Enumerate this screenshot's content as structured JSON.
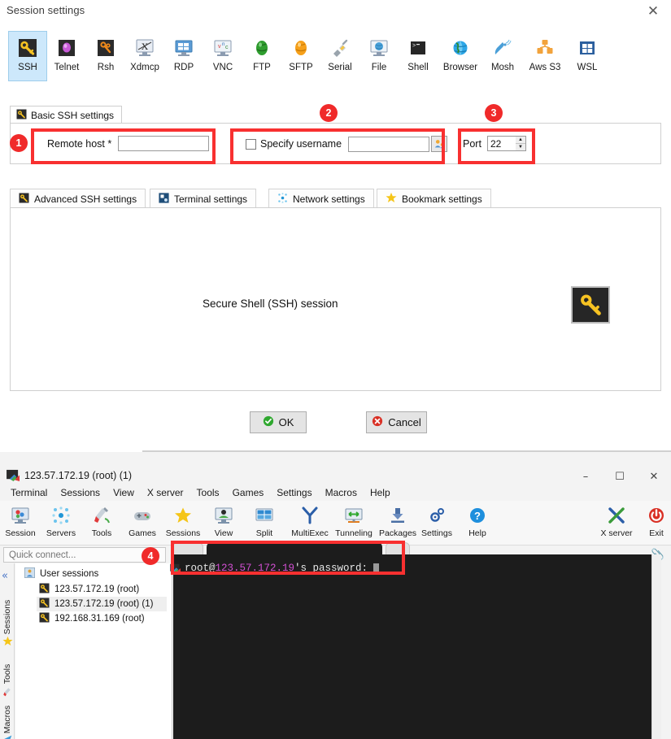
{
  "dialog": {
    "title": "Session settings",
    "close_label": "✕",
    "protocols": [
      {
        "label": "SSH",
        "icon": "ssh-key-icon",
        "selected": true
      },
      {
        "label": "Telnet",
        "icon": "telnet-icon",
        "selected": false
      },
      {
        "label": "Rsh",
        "icon": "rsh-icon",
        "selected": false
      },
      {
        "label": "Xdmcp",
        "icon": "xdmcp-icon",
        "selected": false
      },
      {
        "label": "RDP",
        "icon": "rdp-icon",
        "selected": false
      },
      {
        "label": "VNC",
        "icon": "vnc-icon",
        "selected": false
      },
      {
        "label": "FTP",
        "icon": "ftp-globe-icon",
        "selected": false
      },
      {
        "label": "SFTP",
        "icon": "sftp-globe-icon",
        "selected": false
      },
      {
        "label": "Serial",
        "icon": "serial-plug-icon",
        "selected": false
      },
      {
        "label": "File",
        "icon": "file-monitor-icon",
        "selected": false
      },
      {
        "label": "Shell",
        "icon": "shell-console-icon",
        "selected": false
      },
      {
        "label": "Browser",
        "icon": "browser-globe-icon",
        "selected": false
      },
      {
        "label": "Mosh",
        "icon": "mosh-satellite-icon",
        "selected": false
      },
      {
        "label": "Aws S3",
        "icon": "aws-s3-icon",
        "selected": false
      },
      {
        "label": "WSL",
        "icon": "wsl-windows-icon",
        "selected": false
      }
    ],
    "basic_tab": {
      "label": "Basic SSH settings",
      "icon": "ssh-key-icon"
    },
    "basic_fields": {
      "remote_host_label": "Remote host *",
      "remote_host_value": "",
      "remote_host_placeholder": "",
      "specify_username_label": "Specify username",
      "specify_username_checked": false,
      "username_value": "",
      "username_button_icon": "user-picker-icon",
      "port_label": "Port",
      "port_value": "22"
    },
    "sub_tabs": [
      {
        "label": "Advanced SSH settings",
        "icon": "ssh-key-icon",
        "active": true
      },
      {
        "label": "Terminal settings",
        "icon": "terminal-settings-icon",
        "active": false
      },
      {
        "label": "Network settings",
        "icon": "network-settings-icon",
        "active": false
      },
      {
        "label": "Bookmark settings",
        "icon": "star-icon",
        "active": false
      }
    ],
    "panel": {
      "description": "Secure Shell (SSH) session",
      "big_icon": "ssh-key-icon"
    },
    "buttons": {
      "ok_label": "OK",
      "ok_icon": "check-circle-icon",
      "cancel_label": "Cancel",
      "cancel_icon": "cancel-circle-icon"
    }
  },
  "mobaxterm": {
    "window_title": "123.57.172.19 (root) (1)",
    "window_icon": "mobaxterm-app-icon",
    "window_buttons": {
      "minimize": "–",
      "maximize": "☐",
      "close": "✕"
    },
    "menu": [
      "Terminal",
      "Sessions",
      "View",
      "X server",
      "Tools",
      "Games",
      "Settings",
      "Macros",
      "Help"
    ],
    "ribbon_left": [
      {
        "label": "Session",
        "icon": "session-icon"
      },
      {
        "label": "Servers",
        "icon": "servers-icon"
      },
      {
        "label": "Tools",
        "icon": "tools-icon"
      },
      {
        "label": "Games",
        "icon": "gamepad-icon"
      },
      {
        "label": "Sessions",
        "icon": "star-icon"
      },
      {
        "label": "View",
        "icon": "view-icon"
      },
      {
        "label": "Split",
        "icon": "split-icon"
      },
      {
        "label": "MultiExec",
        "icon": "multiexec-icon"
      },
      {
        "label": "Tunneling",
        "icon": "tunneling-icon"
      },
      {
        "label": "Packages",
        "icon": "packages-icon"
      },
      {
        "label": "Settings",
        "icon": "settings-gear-icon"
      },
      {
        "label": "Help",
        "icon": "help-question-icon"
      }
    ],
    "ribbon_right": [
      {
        "label": "X server",
        "icon": "x-server-icon"
      },
      {
        "label": "Exit",
        "icon": "power-exit-icon"
      }
    ],
    "quick_connect_placeholder": "Quick connect...",
    "quick_connect_value": "",
    "clip_icon": "paperclip-icon",
    "rail": {
      "collapse_icon": "double-chevron-left-icon",
      "items": [
        {
          "label": "Sessions",
          "icon": "star-icon"
        },
        {
          "label": "Tools",
          "icon": "tools-icon"
        },
        {
          "label": "Macros",
          "icon": "macro-play-icon"
        }
      ]
    },
    "session_tree": {
      "root_label": "User sessions",
      "root_icon": "user-sessions-icon",
      "items": [
        {
          "label": "123.57.172.19 (root)",
          "icon": "ssh-key-icon",
          "selected": false
        },
        {
          "label": "123.57.172.19 (root) (1)",
          "icon": "ssh-key-icon",
          "selected": true
        },
        {
          "label": "192.168.31.169 (root)",
          "icon": "ssh-key-icon",
          "selected": false
        }
      ]
    },
    "terminal": {
      "icon": "mobaxterm-app-icon",
      "prompt_prefix": "root@",
      "prompt_host": "123.57.172.19",
      "prompt_suffix": "'s password: ",
      "background": "#1c1c1c",
      "host_color": "#d24fd2",
      "text_color": "#e6e6e6"
    }
  },
  "annotations": {
    "color": "#f83030",
    "badges": [
      {
        "number": "1",
        "target": "remote-host-field"
      },
      {
        "number": "2",
        "target": "specify-username-field"
      },
      {
        "number": "3",
        "target": "port-field"
      },
      {
        "number": "4",
        "target": "terminal-password-prompt"
      }
    ]
  }
}
